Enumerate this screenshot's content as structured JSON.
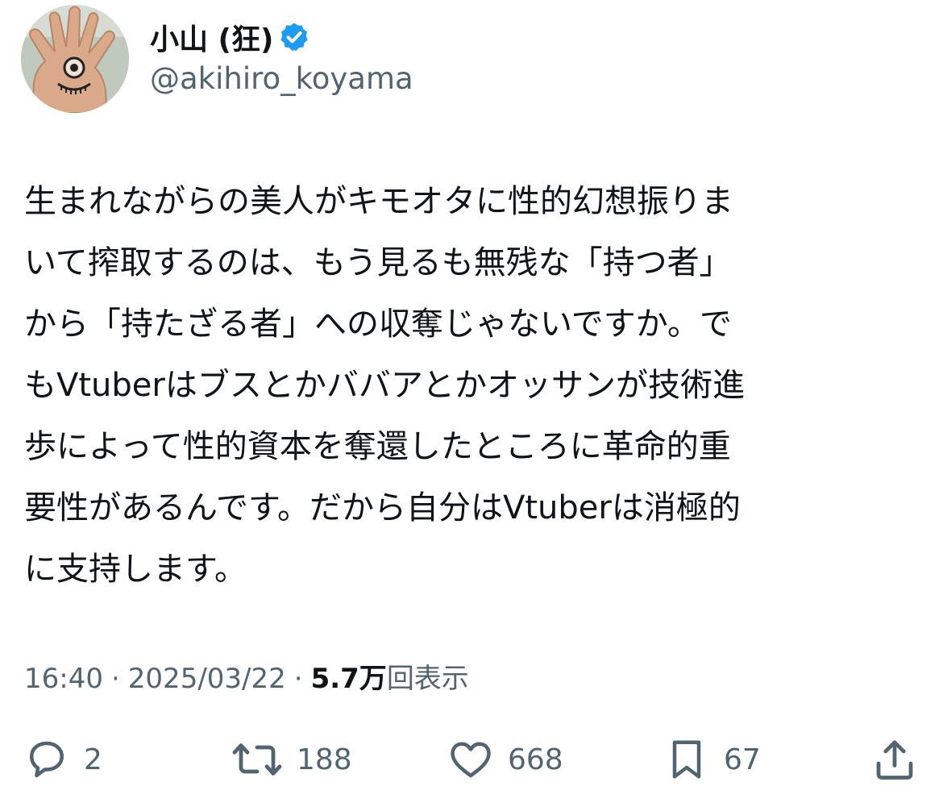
{
  "author": {
    "display_name": "小山 (狂)",
    "handle": "@akihiro_koyama",
    "verified_icon": "verified-badge-icon",
    "avatar_icon": "hand-eye-avatar"
  },
  "tweet": {
    "lines": [
      "生まれながらの美人がキモオタに性的幻想振りま",
      "いて搾取するのは、もう見るも無残な「持つ者」",
      "から「持たざる者」への収奪じゃないですか。で",
      "もVtuberはブスとかババアとかオッサンが技術進",
      "歩によって性的資本を奪還したところに革命的重",
      "要性があるんです。だから自分はVtuberは消極的",
      "に支持します。"
    ]
  },
  "meta": {
    "time": "16:40",
    "separator": "·",
    "date": "2025/03/22",
    "views_count": "5.7万",
    "views_label": "回表示"
  },
  "actions": {
    "reply": {
      "icon": "reply-bubble-icon",
      "count": "2"
    },
    "retweet": {
      "icon": "retweet-icon",
      "count": "188"
    },
    "like": {
      "icon": "heart-icon",
      "count": "668"
    },
    "bookmark": {
      "icon": "bookmark-icon",
      "count": "67"
    },
    "share": {
      "icon": "share-upload-icon"
    }
  },
  "colors": {
    "text_primary": "#0f1419",
    "text_secondary": "#536471",
    "verified_blue": "#1d9bf0"
  }
}
